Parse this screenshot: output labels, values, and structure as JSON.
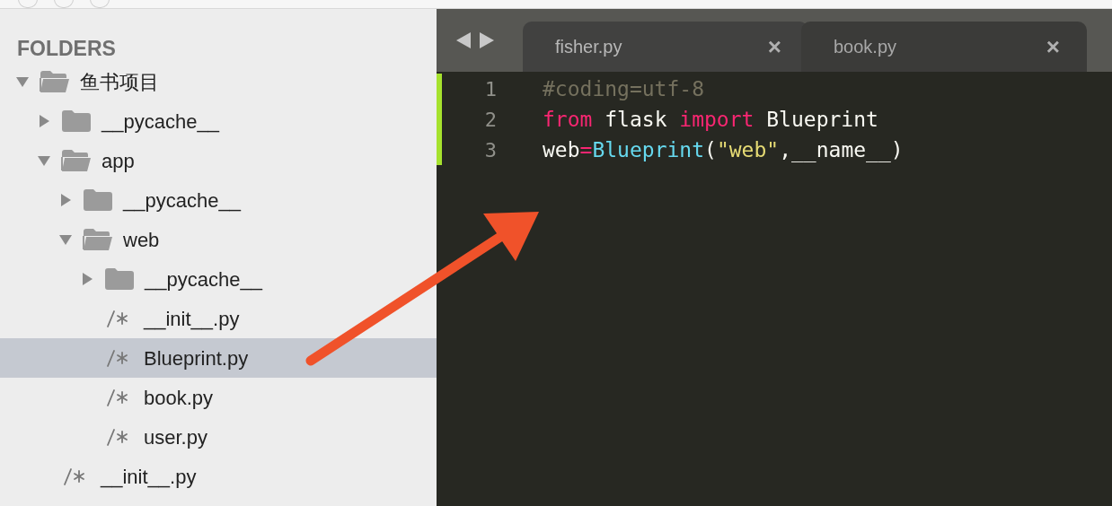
{
  "sidebar": {
    "title": "FOLDERS",
    "tree": [
      {
        "kind": "folder",
        "name": "鱼书项目",
        "expanded": true,
        "selected": false,
        "children": [
          {
            "kind": "folder",
            "name": "__pycache__",
            "expanded": false,
            "selected": false
          },
          {
            "kind": "folder",
            "name": "app",
            "expanded": true,
            "selected": false,
            "children": [
              {
                "kind": "folder",
                "name": "__pycache__",
                "expanded": false,
                "selected": false
              },
              {
                "kind": "folder",
                "name": "web",
                "expanded": true,
                "selected": false,
                "children": [
                  {
                    "kind": "folder",
                    "name": "__pycache__",
                    "expanded": false,
                    "selected": false
                  },
                  {
                    "kind": "file",
                    "name": "__init__.py",
                    "selected": false
                  },
                  {
                    "kind": "file",
                    "name": "Blueprint.py",
                    "selected": true
                  },
                  {
                    "kind": "file",
                    "name": "book.py",
                    "selected": false
                  },
                  {
                    "kind": "file",
                    "name": "user.py",
                    "selected": false
                  }
                ]
              }
            ]
          },
          {
            "kind": "file",
            "name": "__init__.py",
            "selected": false
          }
        ]
      }
    ]
  },
  "tabs": [
    {
      "label": "fisher.py",
      "selected": true,
      "close": "×"
    },
    {
      "label": "book.py",
      "selected": false,
      "close": "×"
    }
  ],
  "editor": {
    "lines": [
      {
        "number": "1",
        "modified": true,
        "tokens": [
          {
            "kind": "comment",
            "text": "#coding=utf-8"
          }
        ]
      },
      {
        "number": "2",
        "modified": true,
        "tokens": [
          {
            "kind": "keyword",
            "text": "from"
          },
          {
            "kind": "plain",
            "text": " flask "
          },
          {
            "kind": "keyword",
            "text": "import"
          },
          {
            "kind": "plain",
            "text": " Blueprint"
          }
        ]
      },
      {
        "number": "3",
        "modified": true,
        "tokens": [
          {
            "kind": "plain",
            "text": "web"
          },
          {
            "kind": "keyword",
            "text": "="
          },
          {
            "kind": "call",
            "text": "Blueprint"
          },
          {
            "kind": "plain",
            "text": "("
          },
          {
            "kind": "string",
            "text": "\"web\""
          },
          {
            "kind": "plain",
            "text": ",__name__)"
          }
        ]
      }
    ]
  }
}
